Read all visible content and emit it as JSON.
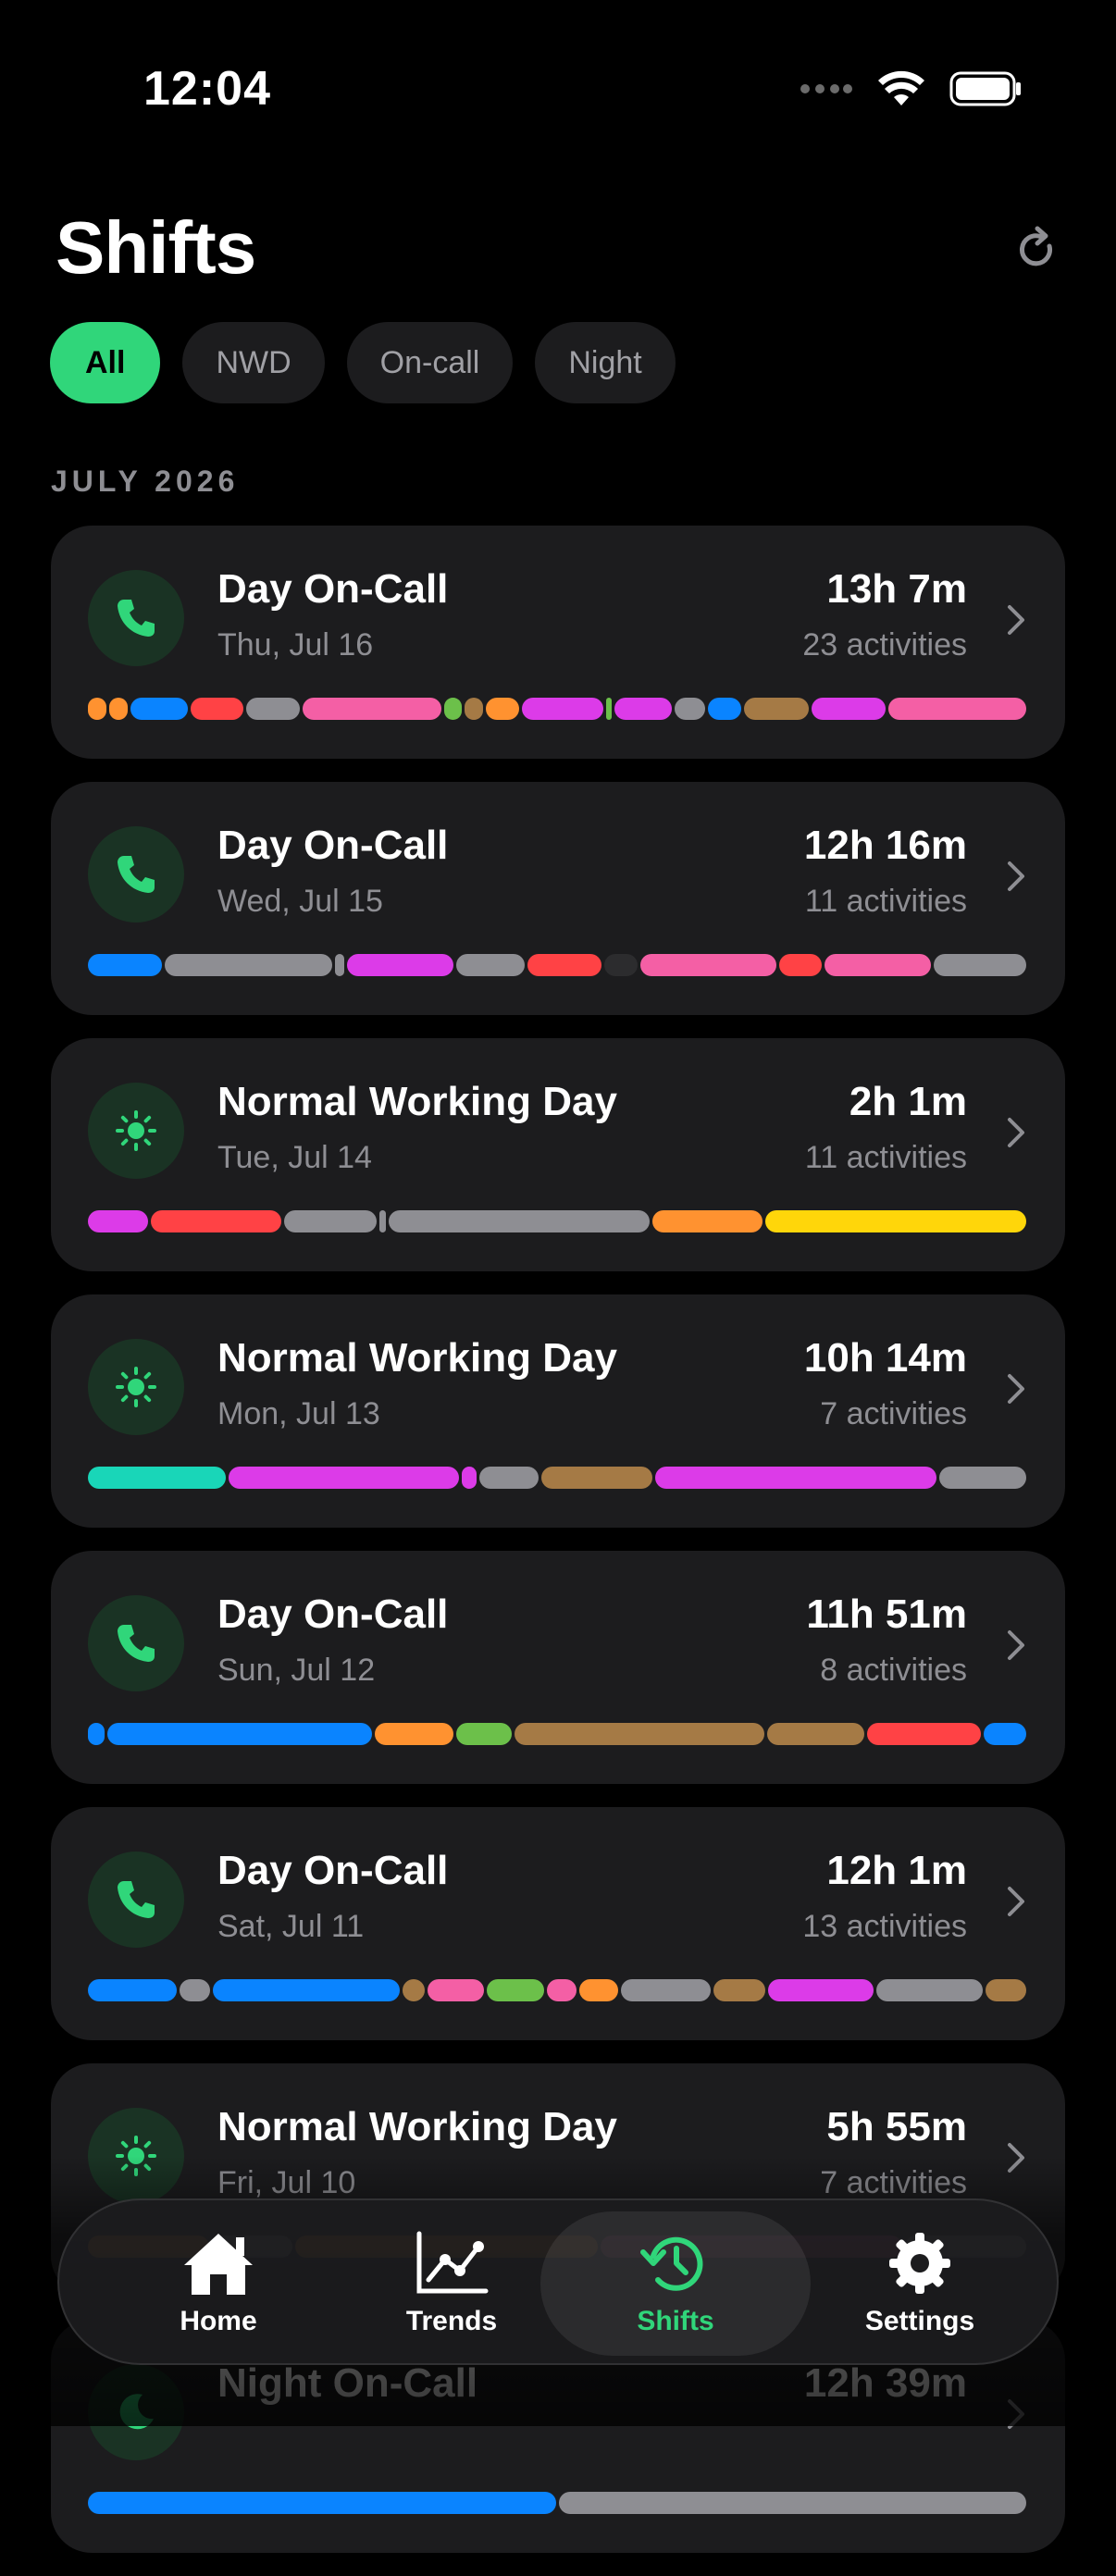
{
  "status_bar": {
    "time": "12:04"
  },
  "header": {
    "title": "Shifts"
  },
  "filters": [
    {
      "label": "All",
      "active": true
    },
    {
      "label": "NWD",
      "active": false
    },
    {
      "label": "On-call",
      "active": false
    },
    {
      "label": "Night",
      "active": false
    }
  ],
  "section": {
    "title": "JULY 2026"
  },
  "shifts": [
    {
      "title": "Day On-Call",
      "date": "Thu, Jul 16",
      "duration": "13h 7m",
      "activities": "23 activities",
      "icon": "phone-icon"
    },
    {
      "title": "Day On-Call",
      "date": "Wed, Jul 15",
      "duration": "12h 16m",
      "activities": "11 activities",
      "icon": "phone-icon"
    },
    {
      "title": "Normal Working Day",
      "date": "Tue, Jul 14",
      "duration": "2h 1m",
      "activities": "11 activities",
      "icon": "sun-icon"
    },
    {
      "title": "Normal Working Day",
      "date": "Mon, Jul 13",
      "duration": "10h 14m",
      "activities": "7 activities",
      "icon": "sun-icon"
    },
    {
      "title": "Day On-Call",
      "date": "Sun, Jul 12",
      "duration": "11h 51m",
      "activities": "8 activities",
      "icon": "phone-icon"
    },
    {
      "title": "Day On-Call",
      "date": "Sat, Jul 11",
      "duration": "12h 1m",
      "activities": "13 activities",
      "icon": "phone-icon"
    },
    {
      "title": "Normal Working Day",
      "date": "Fri, Jul 10",
      "duration": "5h 55m",
      "activities": "7 activities",
      "icon": "sun-icon"
    },
    {
      "title": "Night On-Call",
      "date": "",
      "duration": "12h 39m",
      "activities": "",
      "icon": "moon-icon"
    }
  ],
  "tabbar": {
    "items": [
      {
        "label": "Home",
        "icon": "house-icon",
        "active": false
      },
      {
        "label": "Trends",
        "icon": "chart-icon",
        "active": false
      },
      {
        "label": "Shifts",
        "icon": "clock-history-icon",
        "active": true
      },
      {
        "label": "Settings",
        "icon": "gear-icon",
        "active": false
      }
    ]
  },
  "colors": {
    "accent": "#30d67a",
    "background": "#000000",
    "card": "#1c1c1e",
    "secondary_text": "#8e8e93",
    "activity_palette": {
      "orange": "#ff9230",
      "blue": "#0a84ff",
      "red": "#ff4245",
      "gray": "#8e8e93",
      "pink": "#f45fa5",
      "green": "#6cc04a",
      "brown": "#a57a45",
      "magenta": "#dc3be8",
      "teal": "#19d6b8",
      "yellow": "#ffd60a",
      "dark": "#2c2c2e"
    }
  }
}
